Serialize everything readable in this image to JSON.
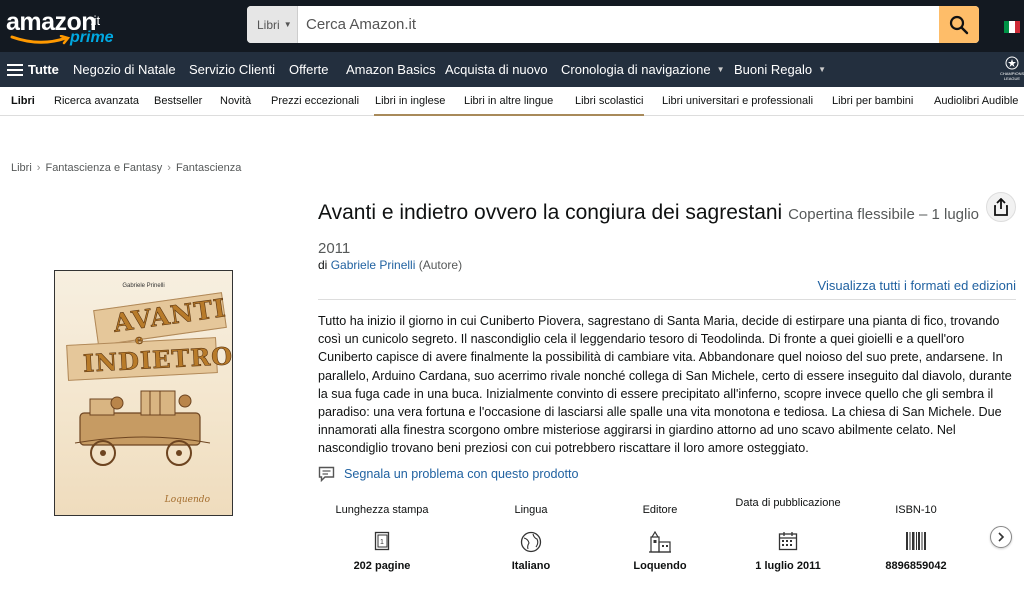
{
  "header": {
    "logo_text": "amazon",
    "logo_tld": ".it",
    "logo_prime": "prime",
    "search_category": "Libri",
    "search_placeholder": "Cerca Amazon.it",
    "flag_colors": [
      "#009246",
      "#ffffff",
      "#ce2b37"
    ]
  },
  "nav": {
    "all_label": "Tutte",
    "items": [
      {
        "label": "Negozio di Natale"
      },
      {
        "label": "Servizio Clienti"
      },
      {
        "label": "Offerte"
      },
      {
        "label": "Amazon Basics"
      },
      {
        "label": "Acquista di nuovo"
      },
      {
        "label": "Cronologia di navigazione"
      },
      {
        "label": "Buoni Regalo"
      }
    ],
    "badge_text": "CHAMPIONS LEAGUE"
  },
  "subnav": {
    "items": [
      {
        "label": "Libri"
      },
      {
        "label": "Ricerca avanzata"
      },
      {
        "label": "Bestseller"
      },
      {
        "label": "Novità"
      },
      {
        "label": "Prezzi eccezionali"
      },
      {
        "label": "Libri in inglese"
      },
      {
        "label": "Libri in altre lingue"
      },
      {
        "label": "Libri scolastici"
      },
      {
        "label": "Libri universitari e professionali"
      },
      {
        "label": "Libri per bambini"
      },
      {
        "label": "Audiolibri Audible"
      }
    ]
  },
  "breadcrumb": [
    "Libri",
    "Fantascienza e Fantasy",
    "Fantascienza"
  ],
  "cover": {
    "author": "Gabriele Prinelli",
    "line1": "AVANTI",
    "line2": "e",
    "line3": "INDIETRO",
    "publisher": "Loquendo"
  },
  "product": {
    "title": "Avanti e indietro ovvero la congiura dei sagrestani",
    "format": "Copertina flessibile – 1 luglio 2011",
    "by_prefix": "di",
    "author": "Gabriele Prinelli",
    "author_role": "(Autore)",
    "all_formats": "Visualizza tutti i formati ed edizioni",
    "description": "Tutto ha inizio il giorno in cui Cuniberto Piovera, sagrestano di Santa Maria, decide di estirpare una pianta di fico, trovando così un cunicolo segreto. Il nascondiglio cela il leggendario tesoro di Teodolinda. Di fronte a quei gioielli e a quell'oro Cuniberto capisce di avere finalmente la possibilità di cambiare vita. Abbandonare quel noioso del suo prete, andarsene. In parallelo, Arduino Cardana, suo acerrimo rivale nonché collega di San Michele, certo di essere inseguito dal diavolo, durante la sua fuga cade in una buca. Inizialmente convinto di essere precipitato all'inferno, scopre invece quello che gli sembra il paradiso: una vera fortuna e l'occasione di lasciarsi alle spalle una vita monotona e tediosa. La chiesa di San Michele. Due innamorati alla finestra scorgono ombre misteriose aggirarsi in giardino attorno ad uno scavo abilmente celato. Nel nascondiglio trovano beni preziosi con cui potrebbero riscattare il loro amore osteggiato.",
    "report_label": "Segnala un problema con questo prodotto"
  },
  "details": [
    {
      "label": "Lunghezza stampa",
      "icon": "book-pages-icon",
      "value": "202 pagine"
    },
    {
      "label": "Lingua",
      "icon": "globe-icon",
      "value": "Italiano"
    },
    {
      "label": "Editore",
      "icon": "building-icon",
      "value": "Loquendo"
    },
    {
      "label": "Data di pubblicazione",
      "icon": "calendar-icon",
      "value": "1 luglio 2011"
    },
    {
      "label": "ISBN-10",
      "icon": "barcode-icon",
      "value": "8896859042"
    }
  ]
}
